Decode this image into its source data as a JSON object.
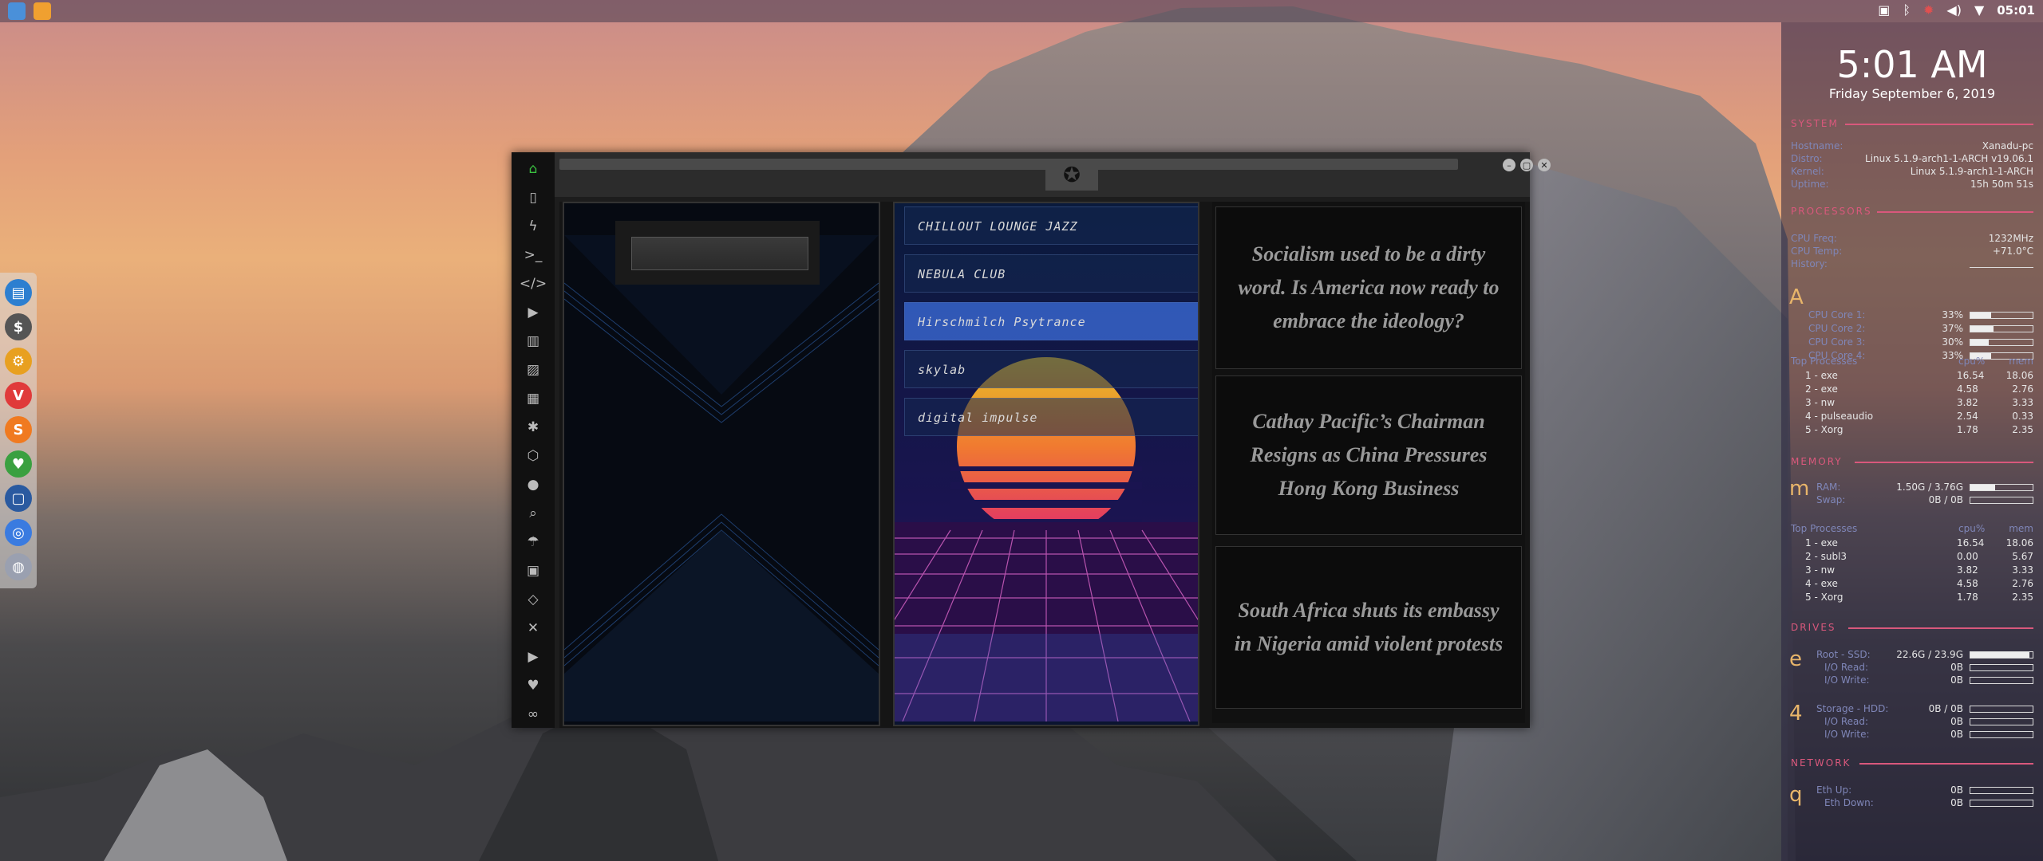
{
  "colors": {
    "accent": "#d9587c",
    "label": "#7f86b8",
    "drive_letter": "#e8b56a",
    "active_station": "#3c6edc"
  },
  "topbar": {
    "time": "05:01",
    "icons": [
      "folder-icon",
      "sublime-icon"
    ],
    "tray": [
      "screenshot-icon",
      "bluetooth-icon",
      "notification-icon",
      "volume-icon",
      "wifi-icon"
    ]
  },
  "dock": {
    "items": [
      "files-icon",
      "money-icon",
      "settings-icon",
      "vivaldi-icon",
      "sublime-icon",
      "monitor-icon",
      "display-icon",
      "chrome-icon",
      "globe-icon"
    ]
  },
  "window": {
    "sidebar_icons": [
      "home-icon",
      "document-icon",
      "flash-icon",
      "terminal-icon",
      "code-icon",
      "play-icon",
      "book-icon",
      "image-icon",
      "news-icon",
      "star-icon",
      "hexagon-icon",
      "globe-icon",
      "search-icon",
      "umbrella-icon",
      "contact-icon",
      "link-icon",
      "expand-icon",
      "youtube-icon",
      "heart-icon",
      "infinity-icon"
    ],
    "emblem": "rebel-alliance-icon",
    "stations": [
      "CHILLOUT LOUNGE JAZZ",
      "NEBULA CLUB",
      "Hirschmilch Psytrance",
      "skylab",
      "digital impulse"
    ],
    "active_station_index": 2,
    "news": [
      "Socialism used to be a dirty word. Is America now ready to embrace the ideology?",
      "Cathay Pacific’s Chairman Resigns as China Pressures Hong Kong Business",
      "South Africa shuts its embassy in Nigeria amid violent protests"
    ]
  },
  "conky": {
    "time": "5:01 AM",
    "date": "Friday September  6, 2019",
    "system": {
      "title": "SYSTEM",
      "hostname_label": "Hostname:",
      "hostname": "Xanadu-pc",
      "distro_label": "Distro:",
      "distro": "Linux 5.1.9-arch1-1-ARCH v19.06.1",
      "kernel_label": "Kernel:",
      "kernel": "Linux 5.1.9-arch1-1-ARCH",
      "uptime_label": "Uptime:",
      "uptime": "15h 50m 51s"
    },
    "processors": {
      "title": "PROCESSORS",
      "freq_label": "CPU Freq:",
      "freq": "1232MHz",
      "temp_label": "CPU Temp:",
      "temp": "+71.0°C",
      "history_label": "History:",
      "letter": "A",
      "cores": [
        {
          "label": "CPU Core 1:",
          "value": "33%",
          "pct": 0.33
        },
        {
          "label": "CPU Core 2:",
          "value": "37%",
          "pct": 0.37
        },
        {
          "label": "CPU Core 3:",
          "value": "30%",
          "pct": 0.3
        },
        {
          "label": "CPU Core 4:",
          "value": "33%",
          "pct": 0.33
        }
      ],
      "top_label": "Top Processes",
      "cpu_header": "cpu%",
      "mem_header": "mem",
      "procs": [
        {
          "name": "1 - exe",
          "cpu": "16.54",
          "mem": "18.06"
        },
        {
          "name": "2 - exe",
          "cpu": "4.58",
          "mem": "2.76"
        },
        {
          "name": "3 - nw",
          "cpu": "3.82",
          "mem": "3.33"
        },
        {
          "name": "4 - pulseaudio",
          "cpu": "2.54",
          "mem": "0.33"
        },
        {
          "name": "5 - Xorg",
          "cpu": "1.78",
          "mem": "2.35"
        }
      ]
    },
    "memory": {
      "title": "MEMORY",
      "letter": "m",
      "ram_label": "RAM:",
      "ram": "1.50G / 3.76G",
      "ram_pct": 0.4,
      "swap_label": "Swap:",
      "swap": "0B / 0B",
      "swap_pct": 0,
      "top_label": "Top Processes",
      "cpu_header": "cpu%",
      "mem_header": "mem",
      "procs": [
        {
          "name": "1 - exe",
          "cpu": "16.54",
          "mem": "18.06"
        },
        {
          "name": "2 - subl3",
          "cpu": "0.00",
          "mem": "5.67"
        },
        {
          "name": "3 - nw",
          "cpu": "3.82",
          "mem": "3.33"
        },
        {
          "name": "4 - exe",
          "cpu": "4.58",
          "mem": "2.76"
        },
        {
          "name": "5 - Xorg",
          "cpu": "1.78",
          "mem": "2.35"
        }
      ]
    },
    "drives": {
      "title": "DRIVES",
      "letter1": "e",
      "root_label": "Root - SSD:",
      "root": "22.6G / 23.9G",
      "root_pct": 0.95,
      "io_read_label": "I/O Read:",
      "io_read": "0B",
      "io_write_label": "I/O Write:",
      "io_write": "0B",
      "letter2": "4",
      "storage_label": "Storage - HDD:",
      "storage": "0B / 0B",
      "storage_pct": 0,
      "io_read2": "0B",
      "io_write2": "0B"
    },
    "network": {
      "title": "NETWORK",
      "letter": "q",
      "up_label": "Eth Up:",
      "up": "0B",
      "down_label": "Eth Down:",
      "down": "0B"
    }
  }
}
